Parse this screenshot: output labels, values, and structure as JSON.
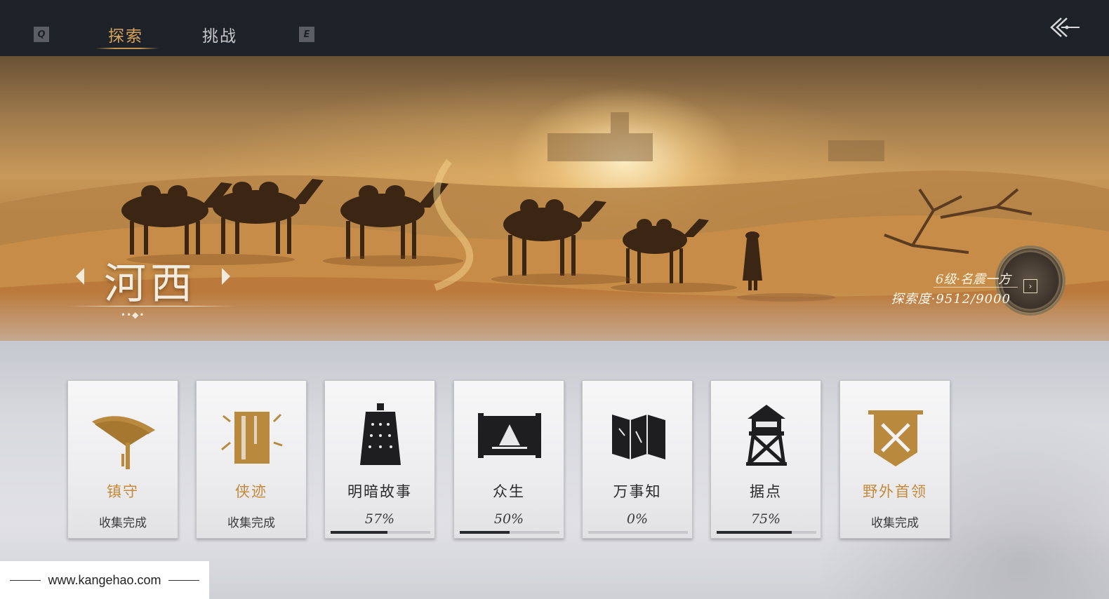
{
  "nav": {
    "key_left": "Q",
    "key_right": "E",
    "tabs": [
      {
        "label": "探索",
        "active": true
      },
      {
        "label": "挑战",
        "active": false
      }
    ],
    "back_icon": "double-chevron-left-icon"
  },
  "region": {
    "name": "河西",
    "dots": "••◆•",
    "rank": "6级·名震一方",
    "exploration": "探索度·9512/9000",
    "map_button_icon": "chevron-right-icon"
  },
  "categories": [
    {
      "title": "镇守",
      "status": "收集完成",
      "icon": "parasol-icon",
      "title_color": "gold"
    },
    {
      "title": "侠迹",
      "status": "收集完成",
      "icon": "book-icon",
      "title_color": "gold"
    },
    {
      "title": "明暗故事",
      "percent": "57%",
      "progress": 0.57,
      "icon": "bell-icon",
      "title_color": "dark"
    },
    {
      "title": "众生",
      "percent": "50%",
      "progress": 0.5,
      "icon": "scroll-painting-icon",
      "title_color": "dark"
    },
    {
      "title": "万事知",
      "percent": "0%",
      "progress": 0.0,
      "icon": "folded-map-icon",
      "title_color": "dark"
    },
    {
      "title": "据点",
      "percent": "75%",
      "progress": 0.75,
      "icon": "watchtower-icon",
      "title_color": "dark"
    },
    {
      "title": "野外首领",
      "status": "收集完成",
      "icon": "banner-crossed-swords-icon",
      "title_color": "gold"
    }
  ],
  "footer": {
    "url": "www.kangehao.com"
  },
  "colors": {
    "gold": "#c4893a",
    "dark": "#2a2a2c",
    "topbar": "#1d2228",
    "active_tab": "#d6a35a"
  }
}
